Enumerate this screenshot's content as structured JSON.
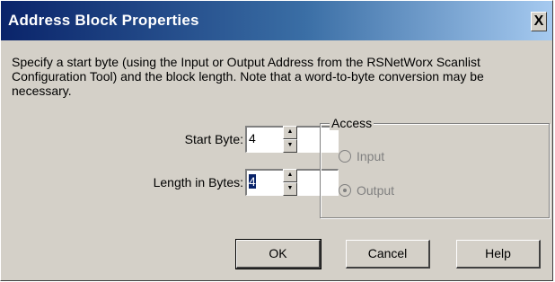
{
  "dialog": {
    "title": "Address Block Properties",
    "close_glyph": "X",
    "description": "Specify a start byte (using the Input or Output Address from the RSNetWorx Scanlist Configuration Tool) and the block length. Note that a word-to-byte conversion may be necessary."
  },
  "fields": {
    "start_byte": {
      "label": "Start Byte:",
      "value": "4"
    },
    "length_in_bytes": {
      "label": "Length in Bytes:",
      "value": "4"
    }
  },
  "access": {
    "legend": "Access",
    "options": [
      {
        "label": "Input",
        "selected": false,
        "enabled": false
      },
      {
        "label": "Output",
        "selected": true,
        "enabled": false
      }
    ]
  },
  "buttons": {
    "ok": "OK",
    "cancel": "Cancel",
    "help": "Help"
  },
  "icons": {
    "spin_up": "up-arrow-icon",
    "spin_down": "down-arrow-icon"
  }
}
